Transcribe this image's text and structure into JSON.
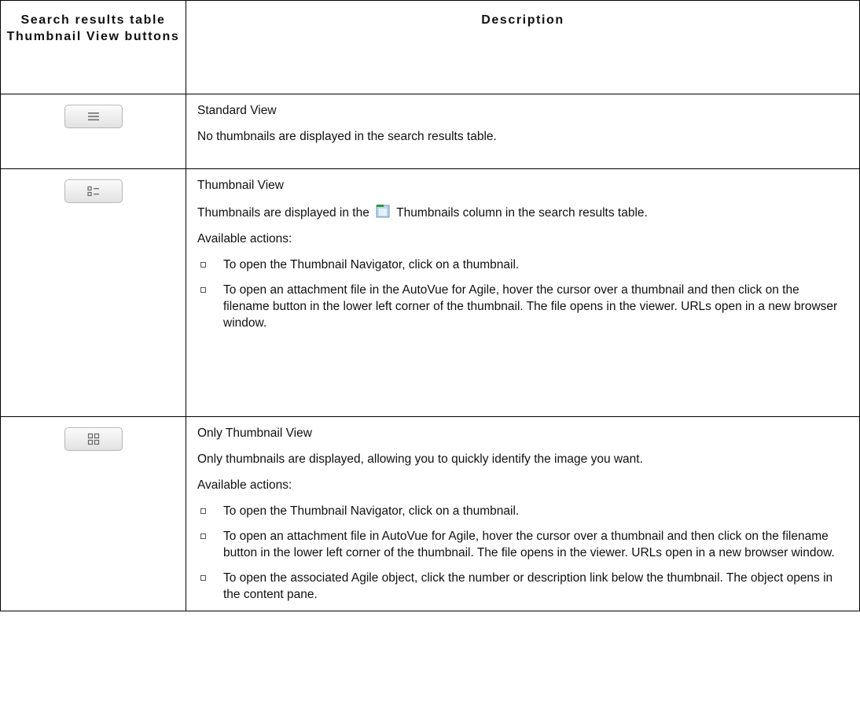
{
  "header": {
    "col1": "Search results table Thumbnail View buttons",
    "col2": "Description"
  },
  "rows": [
    {
      "button_icon": "standard-view-icon",
      "title": "Standard View",
      "text": "No thumbnails are displayed in the search results table."
    },
    {
      "button_icon": "thumbnail-view-icon",
      "title": "Thumbnail View",
      "text_before_icon": "Thumbnails are displayed in the",
      "inline_icon": "thumbnails-column-icon",
      "text_after_icon": "Thumbnails column in the search results table.",
      "actions_label": "Available actions:",
      "actions": [
        "To open the Thumbnail Navigator, click on a thumbnail.",
        "To open an attachment file in the AutoVue for Agile, hover the cursor over a thumbnail and then click on the filename button in the lower left corner of the thumbnail. The file opens in the viewer. URLs open in a new browser window."
      ]
    },
    {
      "button_icon": "only-thumbnail-view-icon",
      "title": "Only Thumbnail View",
      "text": "Only thumbnails are displayed, allowing you to quickly identify the image you want.",
      "actions_label": "Available actions:",
      "actions": [
        "To open the Thumbnail Navigator, click on a thumbnail.",
        "To open an attachment file in AutoVue for Agile, hover the cursor over a thumbnail and then click on the filename button in the lower left corner of the thumbnail. The file opens in the viewer. URLs open in a new browser window.",
        "To open the associated Agile object, click the number or description link below the thumbnail. The object opens in the content pane."
      ]
    }
  ]
}
